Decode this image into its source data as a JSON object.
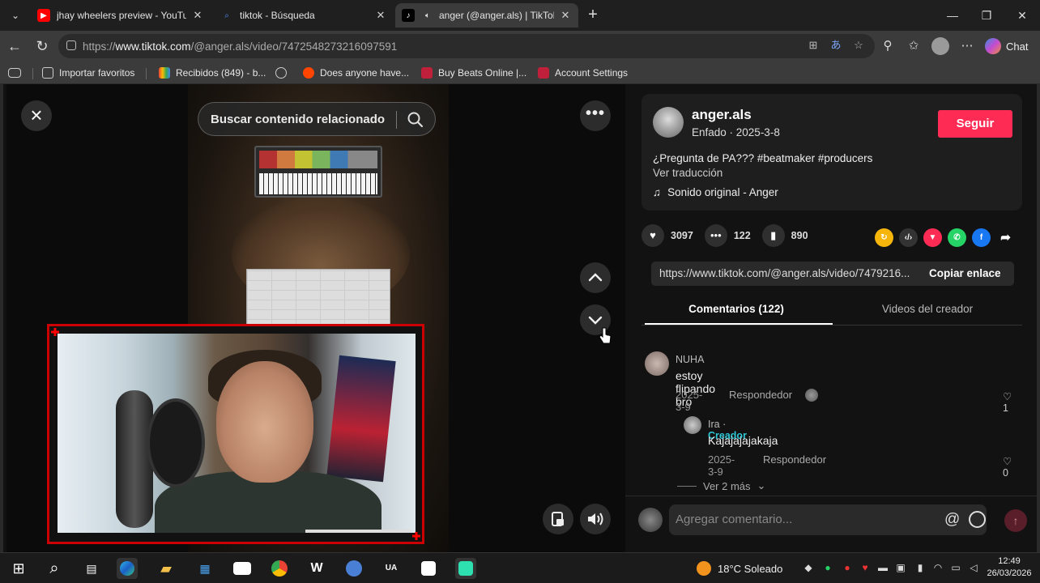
{
  "browser": {
    "tabs": [
      {
        "title": "jhay wheelers preview - YouTube",
        "icon": "youtube-icon"
      },
      {
        "title": "tiktok - Búsqueda",
        "icon": "bing-search-icon"
      },
      {
        "title": "anger (@anger.als) | TikTok",
        "icon": "tiktok-icon",
        "active": true
      }
    ],
    "url_prefix": "https://",
    "url_host": "www.tiktok.com",
    "url_path": "/@anger.als/video/7472548273216097591",
    "chat_label": "Chat",
    "favorites": [
      {
        "label": "Importar favoritos"
      },
      {
        "label": "Recibidos (849) - b..."
      },
      {
        "label": "Does anyone have..."
      },
      {
        "label": "Buy Beats Online |..."
      },
      {
        "label": "Account Settings"
      }
    ]
  },
  "video": {
    "search_placeholder": "Buscar contenido relacionado"
  },
  "post": {
    "author": "anger.als",
    "meta": "Enfado · 2025-3-8",
    "follow_label": "Seguir",
    "description": "¿Pregunta de PA??? #beatmaker #producers",
    "translate_label": "Ver traducción",
    "sound": "Sonido original - Anger",
    "likes": "3097",
    "comments": "122",
    "saves": "890",
    "link": "https://www.tiktok.com/@anger.als/video/7479216...",
    "copy_label": "Copiar enlace"
  },
  "panel_tabs": {
    "comments": "Comentarios (122)",
    "creator_videos": "Videos del creador"
  },
  "comments": [
    {
      "user": "NUHA",
      "text": "estoy flipando bro",
      "date": "2025-3-9",
      "reply": "Respondedor",
      "likes": "1"
    },
    {
      "user": "Ira",
      "creator_tag": "Creador",
      "text": "Kajajajajakaja",
      "date": "2025-3-9",
      "reply": "Respondedor",
      "likes": "0"
    }
  ],
  "more_replies": "Ver 2 más",
  "comment_input_placeholder": "Agregar comentario...",
  "taskbar": {
    "weather": "18°C  Soleado",
    "time": "12:49",
    "date": "26/03/2026"
  },
  "colors": {
    "follow": "#fe2c55",
    "creator": "#2dc6d4",
    "webcam_border": "#cc0000"
  }
}
